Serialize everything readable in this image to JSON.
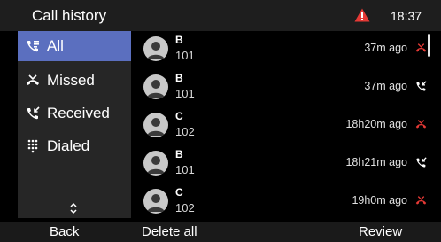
{
  "header": {
    "title": "Call history",
    "warning_icon": "warning-triangle-icon",
    "warning_color": "#e53935",
    "time": "18:37"
  },
  "sidebar": {
    "items": [
      {
        "label": "All",
        "icon": "all-calls-icon",
        "active": true
      },
      {
        "label": "Missed",
        "icon": "missed-call-icon",
        "active": false
      },
      {
        "label": "Received",
        "icon": "received-call-icon",
        "active": false
      },
      {
        "label": "Dialed",
        "icon": "dialpad-icon",
        "active": false
      }
    ],
    "more_icon": "chevron-up-down-icon",
    "active_color": "#5b6fbf"
  },
  "calls": [
    {
      "name": "B",
      "number": "101",
      "time": "37m ago",
      "type": "missed"
    },
    {
      "name": "B",
      "number": "101",
      "time": "37m ago",
      "type": "received"
    },
    {
      "name": "C",
      "number": "102",
      "time": "18h20m ago",
      "type": "missed"
    },
    {
      "name": "B",
      "number": "101",
      "time": "18h21m ago",
      "type": "received"
    },
    {
      "name": "C",
      "number": "102",
      "time": "19h0m ago",
      "type": "missed"
    }
  ],
  "colors": {
    "missed": "#e53935",
    "received": "#ffffff"
  },
  "softkeys": {
    "left": "Back",
    "middle": "Delete all",
    "right": "Review"
  }
}
